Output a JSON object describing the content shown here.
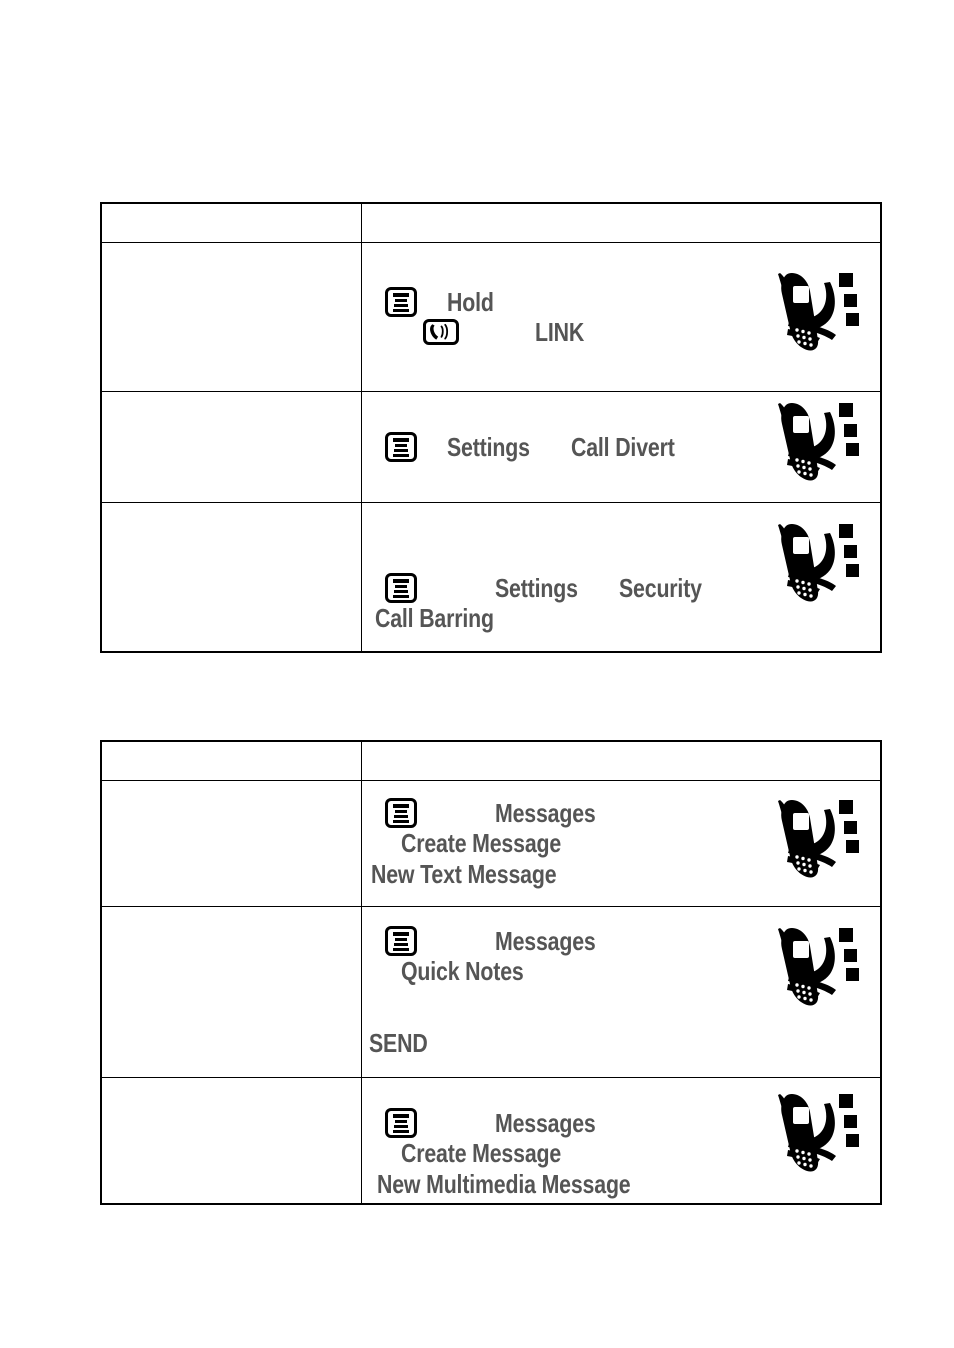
{
  "page": {
    "background_color": "#ffffff",
    "text_color": "#555555",
    "line_color": "#000000"
  },
  "tables": [
    {
      "name": "call-features-table",
      "header": {
        "left": "",
        "right": ""
      },
      "rows": [
        {
          "description": "",
          "lines": [
            {
              "icon": "menu-icon",
              "parts": [
                "Hold"
              ]
            },
            {
              "icon": "speaker-icon",
              "parts": [
                "LINK"
              ]
            }
          ]
        },
        {
          "description": "",
          "lines": [
            {
              "icon": "menu-icon",
              "parts": [
                "Settings",
                "Call Divert"
              ]
            }
          ]
        },
        {
          "description": "",
          "lines": [
            {
              "icon": "menu-icon",
              "parts": [
                "Settings",
                "Security"
              ]
            },
            {
              "icon": null,
              "parts": [
                "Call Barring"
              ]
            }
          ]
        }
      ]
    },
    {
      "name": "messaging-table",
      "header": {
        "left": "",
        "right": ""
      },
      "rows": [
        {
          "description": "",
          "lines": [
            {
              "icon": "menu-icon",
              "parts": [
                "Messages",
                "Create Message"
              ]
            },
            {
              "icon": null,
              "parts": [
                "New Text Message"
              ]
            }
          ]
        },
        {
          "description": "",
          "lines": [
            {
              "icon": "menu-icon",
              "parts": [
                "Messages",
                "Quick Notes"
              ]
            },
            {
              "icon": null,
              "parts": [
                "SEND"
              ]
            }
          ]
        },
        {
          "description": "",
          "lines": [
            {
              "icon": "menu-icon",
              "parts": [
                "Messages",
                "Create Message"
              ]
            },
            {
              "icon": null,
              "parts": [
                "New Multimedia Message"
              ]
            }
          ]
        }
      ]
    }
  ],
  "t1": {
    "r1l1p1": "Hold",
    "r1l2p1": "LINK",
    "r2l1p1": "Settings",
    "r2l1p2": "Call Divert",
    "r3l1p1": "Settings",
    "r3l1p2": "Security",
    "r3l2p1": "Call Barring"
  },
  "t2": {
    "r1l1p1": "Messages",
    "r1l1p2": "Create Message",
    "r1l2p1": "New Text Message",
    "r2l1p1": "Messages",
    "r2l1p2": "Quick Notes",
    "r2l2p1": "SEND",
    "r3l1p1": "Messages",
    "r3l1p2": "Create Message",
    "r3l2p1": "New Multimedia Message"
  },
  "icons": {
    "menu": "menu-icon",
    "speaker": "speaker-icon",
    "phone": "flip-phone-illustration"
  }
}
